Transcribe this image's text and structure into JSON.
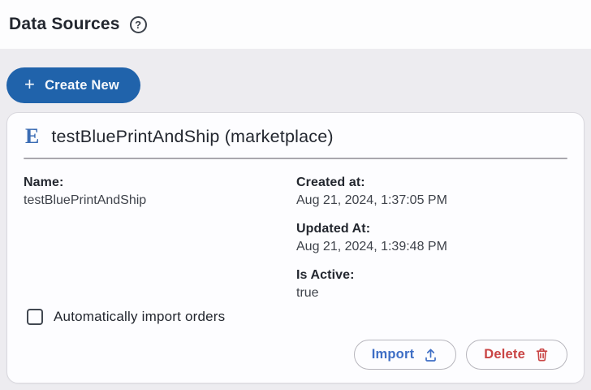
{
  "header": {
    "title": "Data Sources",
    "help_glyph": "?"
  },
  "toolbar": {
    "create_new_label": "Create New",
    "plus_glyph": "+"
  },
  "card": {
    "source_initial": "E",
    "title": "testBluePrintAndShip (marketplace)",
    "columns": [
      {
        "fields": [
          {
            "label": "Name:",
            "value": "testBluePrintAndShip"
          }
        ]
      },
      {
        "fields": [
          {
            "label": "Created at:",
            "value": "Aug 21, 2024, 1:37:05 PM"
          },
          {
            "label": "Updated At:",
            "value": "Aug 21, 2024, 1:39:48 PM"
          },
          {
            "label": "Is Active:",
            "value": "true"
          }
        ]
      }
    ],
    "checkbox": {
      "label": "Automatically import orders",
      "checked": false
    },
    "actions": {
      "import_label": "Import",
      "delete_label": "Delete"
    }
  },
  "colors": {
    "primary_blue": "#2063ab",
    "source_initial_blue": "#3b6cb4",
    "import_blue": "#3e6ec5",
    "delete_red": "#c94444",
    "section_bg": "#edecf0",
    "card_bg": "#fdfdff",
    "card_border": "#d9d8de",
    "divider_gray": "#a9a7ae",
    "text_dark": "#23272f",
    "text_body": "#3f434b"
  }
}
